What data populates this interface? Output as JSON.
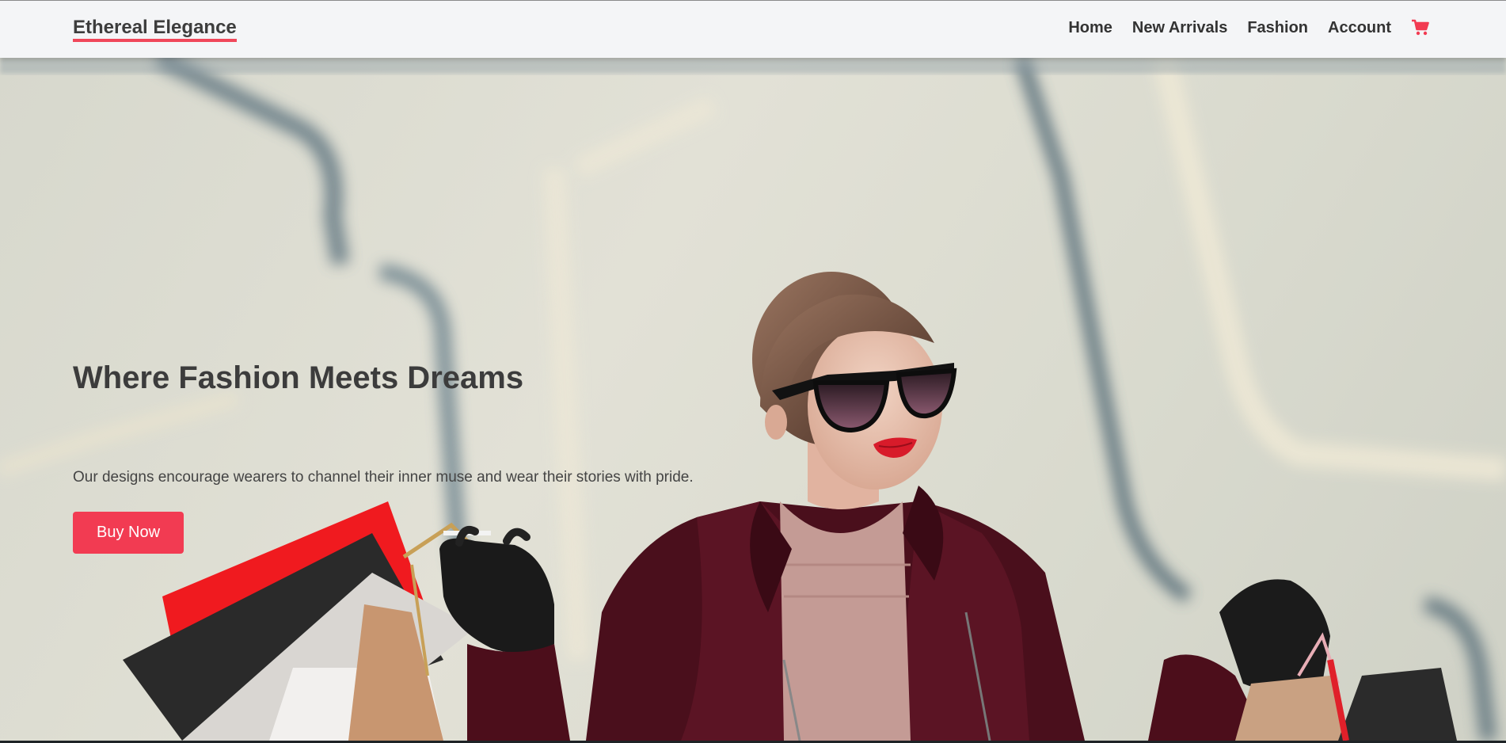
{
  "brand": {
    "name": "Ethereal Elegance"
  },
  "nav": {
    "items": [
      {
        "label": "Home"
      },
      {
        "label": "New Arrivals"
      },
      {
        "label": "Fashion"
      },
      {
        "label": "Account"
      }
    ],
    "cart_icon": "shopping-cart-icon"
  },
  "hero": {
    "title": "Where Fashion Meets Dreams",
    "subtitle": "Our designs encourage wearers to channel their inner muse and wear their stories with pride.",
    "cta_label": "Buy Now",
    "image": "woman-with-shopping-bags-photo"
  },
  "colors": {
    "accent": "#f23b52",
    "text_dark": "#3c3c3c",
    "header_bg": "#f4f5f7"
  }
}
